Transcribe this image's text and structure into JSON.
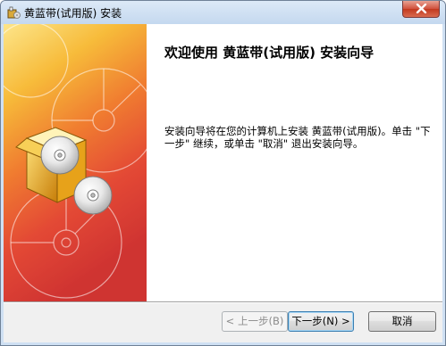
{
  "window": {
    "title": "黄蓝带(试用版) 安装",
    "app_icon": "installer-icon",
    "close_icon": "close-icon"
  },
  "content": {
    "heading": "欢迎使用 黄蓝带(试用版) 安装向导",
    "description": "安装向导将在您的计算机上安装 黄蓝带(试用版)。单击 \"下一步\" 继续，或单击 \"取消\" 退出安装向导。"
  },
  "buttons": {
    "back": "< 上一步(B)",
    "next": "下一步(N) >",
    "cancel": "取消"
  }
}
